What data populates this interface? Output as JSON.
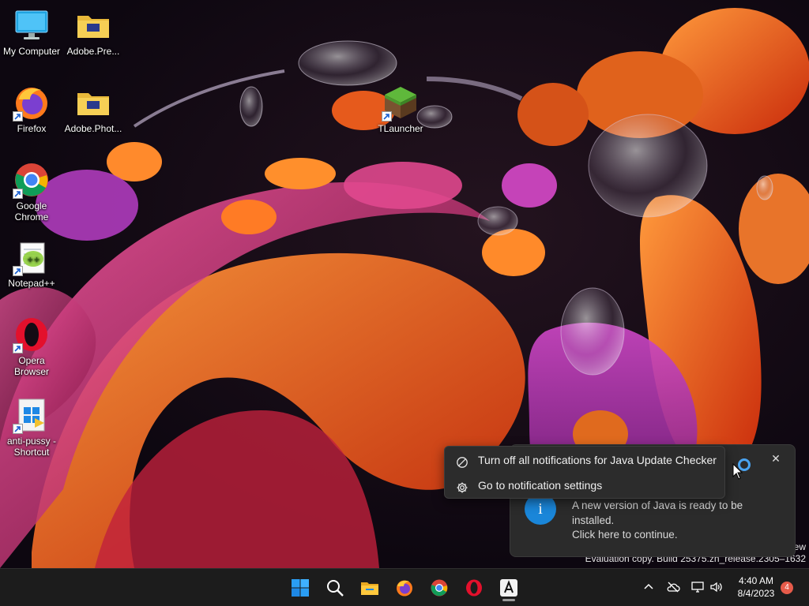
{
  "desktop": {
    "icons": [
      {
        "label": "My Computer",
        "icon": "monitor-icon",
        "shortcut": false
      },
      {
        "label": "Adobe.Pre...",
        "icon": "folder-icon",
        "shortcut": false
      },
      {
        "label": "Firefox",
        "icon": "firefox-icon",
        "shortcut": true
      },
      {
        "label": "Adobe.Phot...",
        "icon": "folder-icon",
        "shortcut": false
      },
      {
        "label": "TLauncher",
        "icon": "minecraft-block-icon",
        "shortcut": true
      },
      {
        "label": "Google Chrome",
        "icon": "chrome-icon",
        "shortcut": true
      },
      {
        "label": "Notepad++",
        "icon": "notepadpp-icon",
        "shortcut": true
      },
      {
        "label": "Opera Browser",
        "icon": "opera-icon",
        "shortcut": true
      },
      {
        "label": "anti-pussy - Shortcut",
        "icon": "windows-shortcut-icon",
        "shortcut": true
      }
    ]
  },
  "notification": {
    "message_line1": "A new version of Java is ready to be",
    "message_line2": "installed.",
    "message_line3": "Click here to continue.",
    "accent_color": "#1a86d9"
  },
  "context_menu": {
    "items": [
      {
        "label": "Turn off all notifications for Java Update Checker",
        "icon": "block-icon"
      },
      {
        "label": "Go to notification settings",
        "icon": "gear-icon"
      }
    ]
  },
  "watermark": {
    "line1": "ew",
    "line2": "Evaluation copy. Build 25375.zn_release.2305–1632"
  },
  "taskbar": {
    "pinned": [
      "start-icon",
      "search-icon",
      "file-explorer-icon",
      "firefox-icon",
      "chrome-icon",
      "opera-icon",
      "adobe-icon"
    ],
    "clock_time": "4:40 AM",
    "clock_date": "8/4/2023",
    "notification_count": "4",
    "badge_color": "#e65b4a"
  }
}
